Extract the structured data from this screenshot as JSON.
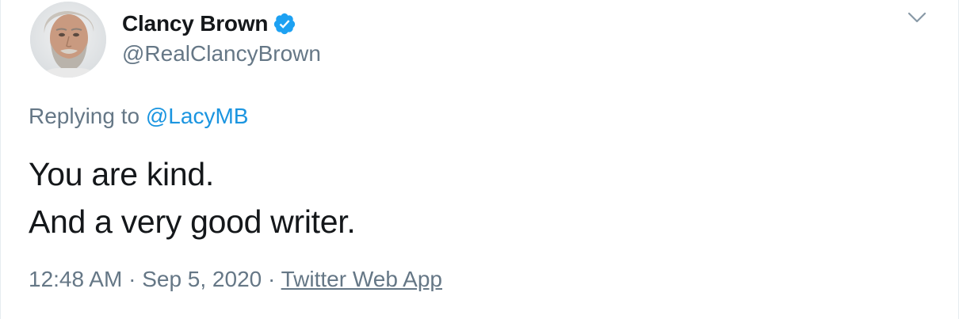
{
  "author": {
    "display_name": "Clancy Brown",
    "handle": "@RealClancyBrown",
    "verified": true,
    "avatar_icon": "user-avatar-photo"
  },
  "reply": {
    "prefix": "Replying to",
    "mention": "@LacyMB"
  },
  "tweet": {
    "lines": [
      "You are kind.",
      "And a very good writer."
    ]
  },
  "meta": {
    "time": "12:48 AM",
    "separator": "·",
    "date": "Sep 5, 2020",
    "source": "Twitter Web App"
  },
  "icons": {
    "verified": "verified-badge-icon",
    "more": "chevron-down-icon"
  },
  "colors": {
    "verified_blue": "#1da1f2",
    "link_blue": "#1b95e0",
    "secondary_text": "#657786",
    "primary_text": "#14171a"
  }
}
